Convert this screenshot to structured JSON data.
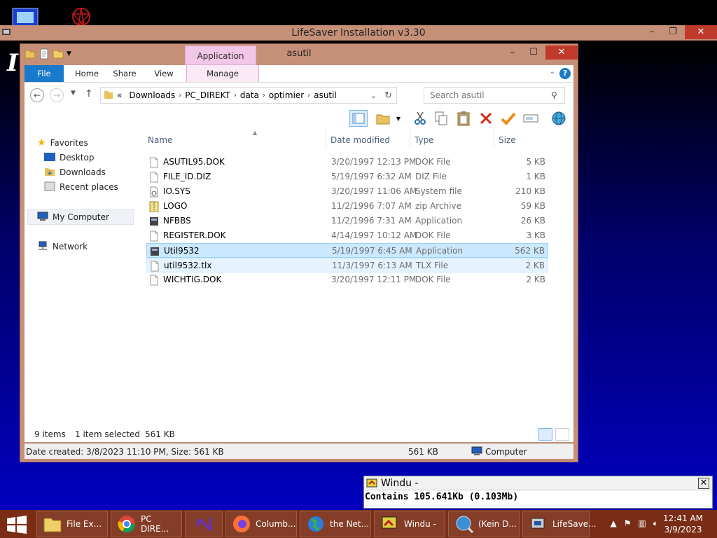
{
  "lifesaver": {
    "title": "LifeSaver Installation v3.30",
    "minimize": "–",
    "maximize": "❐",
    "close": "✕"
  },
  "explorer": {
    "title": "asutil",
    "minimize": "–",
    "maximize": "☐",
    "close": "✕",
    "context_tab_group": "Application Tools",
    "tabs": [
      "File",
      "Home",
      "Share",
      "View",
      "Manage"
    ],
    "address": [
      "Downloads",
      "PC_DIREKT",
      "data",
      "optimier",
      "asutil"
    ],
    "address_overflow": "«",
    "search_placeholder": "Search asutil",
    "nav": {
      "favorites": "Favorites",
      "desktop": "Desktop",
      "downloads": "Downloads",
      "recent": "Recent places",
      "my_computer": "My Computer",
      "network": "Network"
    },
    "columns": {
      "name": "Name",
      "date": "Date modified",
      "type": "Type",
      "size": "Size"
    },
    "files": [
      {
        "name": "ASUTIL95.DOK",
        "date": "3/20/1997 12:13 PM",
        "type": "DOK File",
        "size": "5 KB"
      },
      {
        "name": "FILE_ID.DIZ",
        "date": "5/19/1997 6:32 AM",
        "type": "DIZ File",
        "size": "1 KB"
      },
      {
        "name": "IO.SYS",
        "date": "3/20/1997 11:06 AM",
        "type": "System file",
        "size": "210 KB"
      },
      {
        "name": "LOGO",
        "date": "11/2/1996 7:07 AM",
        "type": "zip Archive",
        "size": "59 KB"
      },
      {
        "name": "NFBBS",
        "date": "11/2/1996 7:31 AM",
        "type": "Application",
        "size": "26 KB"
      },
      {
        "name": "REGISTER.DOK",
        "date": "4/14/1997 10:12 AM",
        "type": "DOK File",
        "size": "3 KB"
      },
      {
        "name": "Util9532",
        "date": "5/19/1997 6:45 AM",
        "type": "Application",
        "size": "562 KB"
      },
      {
        "name": "util9532.tlx",
        "date": "11/3/1997 6:13 AM",
        "type": "TLX File",
        "size": "2 KB"
      },
      {
        "name": "WICHTIG.DOK",
        "date": "3/20/1997 12:11 PM",
        "type": "DOK File",
        "size": "2 KB"
      }
    ],
    "status": {
      "items": "9 items",
      "selected": "1 item selected",
      "selected_size": "561 KB"
    },
    "details": {
      "created": "Date created: 3/8/2023 11:10 PM, Size: 561 KB",
      "size": "561 KB",
      "location": "Computer"
    }
  },
  "windu": {
    "title": "Windu -",
    "body": "Contains 105.641Kb (0.103Mb)",
    "close": "✕"
  },
  "taskbar": {
    "buttons": [
      "File Ex...",
      "PC DIRE...",
      "",
      "Columb...",
      "the Net...",
      "Windu -",
      "(Kein D...",
      "LifeSave..."
    ],
    "time": "12:41 AM",
    "date": "3/9/2023"
  },
  "colors": {
    "lifesaver_frame": "#c69078",
    "taskbar": "#7a2d14",
    "selection": "#cce8ff",
    "file_tab": "#1979ca"
  }
}
